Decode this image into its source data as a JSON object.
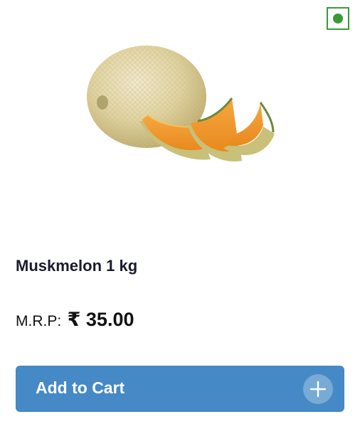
{
  "product": {
    "name": "Muskmelon 1 kg",
    "mrp_label": "M.R.P:",
    "price": "₹ 35.00",
    "veg_indicator": "green",
    "image": "muskmelon-photo"
  },
  "actions": {
    "add_to_cart_label": "Add to Cart",
    "plus_icon": "plus-icon"
  },
  "colors": {
    "accent": "#4589c6",
    "veg_green": "#3a9a3a",
    "title_text": "#1b1b2f"
  }
}
